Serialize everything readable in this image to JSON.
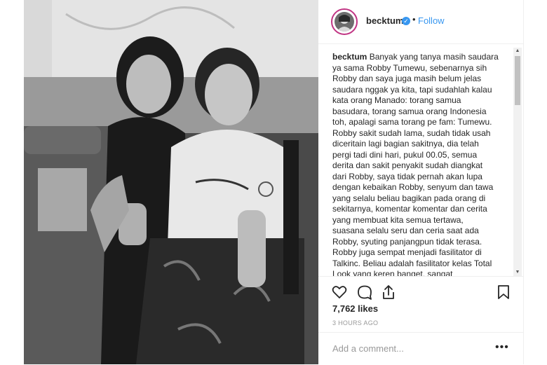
{
  "post": {
    "username": "becktum",
    "follow_label": "Follow",
    "separator": "•",
    "caption_user": "becktum",
    "caption_lines": [
      "Banyak yang tanya masih saudara",
      "ya sama Robby Tumewu, sebenarnya sih",
      "Robby dan saya juga masih belum jelas",
      "saudara nggak ya kita, tapi sudahlah kalau",
      "kata orang Manado: torang samua",
      "basudara, torang samua orang Indonesia",
      "toh, apalagi sama torang pe fam: Tumewu.",
      "Robby sakit sudah lama, sudah tidak usah",
      "diceritain lagi bagian sakitnya, dia telah",
      "pergi tadi dini hari, pukul 00.05, semua",
      "derita dan sakit penyakit sudah diangkat",
      "dari Robby, saya tidak pernah akan lupa",
      "dengan kebaikan Robby, senyum dan tawa",
      "yang selalu beliau bagikan pada orang di",
      "sekitarnya, komentar komentar dan cerita",
      "yang membuat kita semua tertawa,",
      "suasana selalu seru dan ceria saat ada",
      "Robby, syuting panjangpun tidak terasa.",
      "Robby juga sempat menjadi fasilitator di",
      "Talkinc. Beliau adalah fasilitator kelas Total",
      "Look yang keren banget, sangat"
    ],
    "likes": "7,762 likes",
    "time": "3 HOURS AGO",
    "comment_placeholder": "Add a comment...",
    "more_label": "•••"
  },
  "icons": {
    "verified": "verified-badge-icon",
    "like": "heart-icon",
    "comment": "comment-icon",
    "share": "share-icon",
    "save": "bookmark-icon",
    "scroll_up": "▲",
    "scroll_down": "▼"
  },
  "colors": {
    "accent": "#3897f0",
    "text": "#262626",
    "muted": "#999999",
    "border": "#efefef"
  }
}
